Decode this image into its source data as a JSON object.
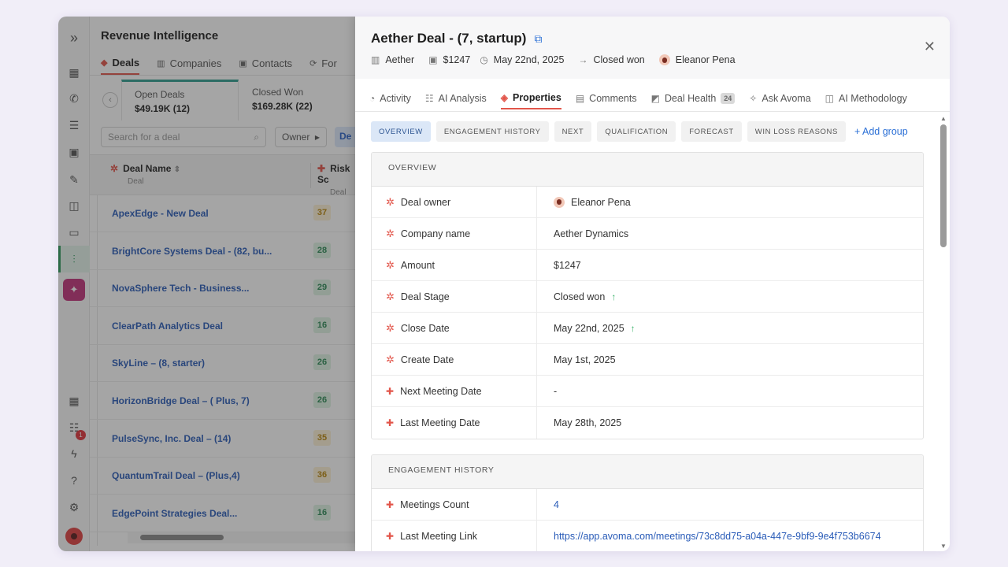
{
  "app": {
    "title": "Revenue Intelligence",
    "tabs": [
      {
        "label": "Deals"
      },
      {
        "label": "Companies"
      },
      {
        "label": "Contacts"
      },
      {
        "label": "For"
      }
    ]
  },
  "list": {
    "summary_cards": [
      {
        "label": "Open Deals",
        "value": "$49.19K (12)"
      },
      {
        "label": "Closed Won",
        "value": "$169.28K (22)"
      }
    ],
    "search_placeholder": "Search for a deal",
    "owner_filter": "Owner",
    "active_filter": "De",
    "columns": [
      {
        "label": "Deal Name",
        "sub": "Deal"
      },
      {
        "label": "Risk Sc",
        "sub": "Deal"
      }
    ],
    "rows": [
      {
        "name": "ApexEdge - New Deal",
        "score": "37",
        "level": "y"
      },
      {
        "name": "BrightCore Systems Deal - (82, bu...",
        "score": "28",
        "level": "g"
      },
      {
        "name": "NovaSphere Tech - Business...",
        "score": "29",
        "level": "g"
      },
      {
        "name": "ClearPath Analytics Deal",
        "score": "16",
        "level": "g"
      },
      {
        "name": "SkyLine – (8, starter)",
        "score": "26",
        "level": "g"
      },
      {
        "name": "HorizonBridge Deal – ( Plus, 7)",
        "score": "26",
        "level": "g"
      },
      {
        "name": "PulseSync, Inc. Deal – (14)",
        "score": "35",
        "level": "y"
      },
      {
        "name": "QuantumTrail Deal – (Plus,4)",
        "score": "36",
        "level": "y"
      },
      {
        "name": "EdgePoint Strategies Deal...",
        "score": "16",
        "level": "g"
      }
    ]
  },
  "rail": {
    "notification_count": "1"
  },
  "drawer": {
    "title": "Aether Deal - (7, startup)",
    "meta": {
      "company": "Aether",
      "amount": "$1247",
      "date": "May 22nd, 2025",
      "stage": "Closed won",
      "owner": "Eleanor Pena"
    },
    "tabs": [
      {
        "label": "Activity",
        "icon": "clock-icon"
      },
      {
        "label": "AI Analysis",
        "icon": "analysis-icon"
      },
      {
        "label": "Properties",
        "icon": "layers-icon"
      },
      {
        "label": "Comments",
        "icon": "comment-icon"
      },
      {
        "label": "Deal Health",
        "icon": "health-icon",
        "badge": "24"
      },
      {
        "label": "Ask Avoma",
        "icon": "chat-spark-icon"
      },
      {
        "label": "AI Methodology",
        "icon": "book-icon"
      }
    ],
    "chips": [
      "OVERVIEW",
      "ENGAGEMENT HISTORY",
      "NEXT",
      "QUALIFICATION",
      "FORECAST",
      "WIN LOSS REASONS"
    ],
    "add_group": "+ Add group",
    "overview": {
      "heading": "OVERVIEW",
      "rows": [
        {
          "label": "Deal owner",
          "value": "Eleanor Pena"
        },
        {
          "label": "Company name",
          "value": "Aether Dynamics"
        },
        {
          "label": "Amount",
          "value": "$1247"
        },
        {
          "label": "Deal Stage",
          "value": "Closed won"
        },
        {
          "label": "Close Date",
          "value": "May 22nd, 2025"
        },
        {
          "label": "Create Date",
          "value": "May 1st, 2025"
        },
        {
          "label": "Next Meeting Date",
          "value": "-"
        },
        {
          "label": "Last Meeting Date",
          "value": "May 28th, 2025"
        }
      ]
    },
    "engagement": {
      "heading": "ENGAGEMENT HISTORY",
      "rows": [
        {
          "label": "Meetings Count",
          "value": "4"
        },
        {
          "label": "Last Meeting Link",
          "value": "https://app.avoma.com/meetings/73c8dd75-a04a-447e-9bf9-9e4f753b6674"
        }
      ]
    }
  }
}
